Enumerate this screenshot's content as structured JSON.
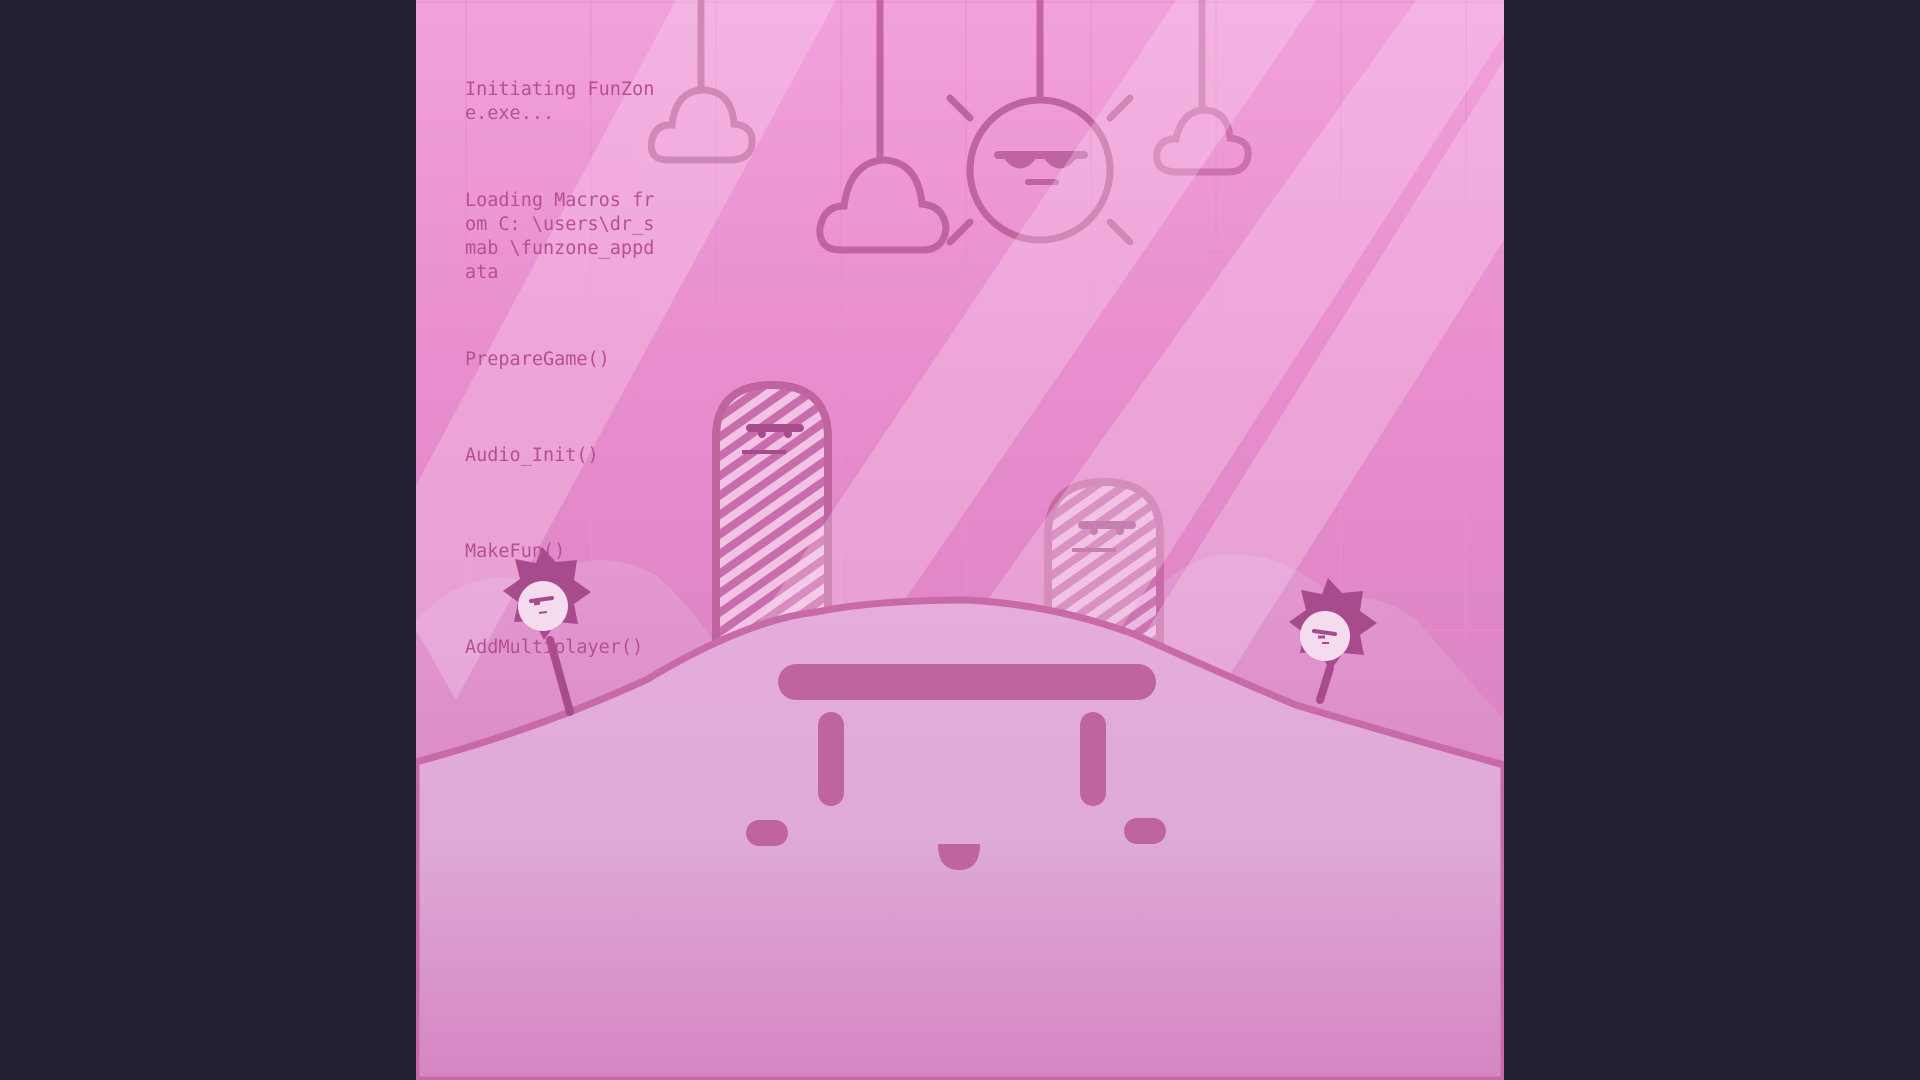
{
  "window": {
    "background": "#222033",
    "game_background": "#ee98d6"
  },
  "boot_log": {
    "lines": [
      "Initiating FunZone.exe...",
      "Loading Macros from C: \\users\\dr_smab \\funzone_appdata",
      "PrepareGame()",
      "Audio_Init()",
      "MakeFun()",
      "AddMultiplayer()"
    ],
    "text_color": "#b84f93"
  },
  "scene": {
    "icons": [
      "hanging-cloud-icon",
      "hanging-cloud-icon",
      "sun-with-sunglasses-icon",
      "hanging-cloud-icon",
      "striped-arch-character-icon",
      "spiky-flower-character-icon",
      "hill-face-character-icon"
    ],
    "accent": "#c0649f",
    "dark_accent": "#a84b8c",
    "light_face": "#f4dbee"
  }
}
